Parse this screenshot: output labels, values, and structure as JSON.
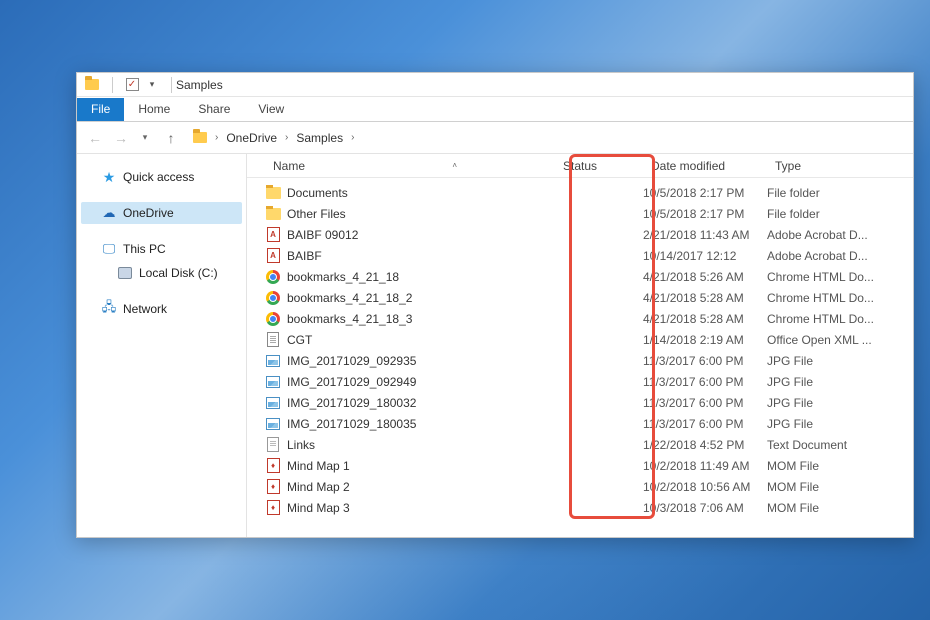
{
  "titlebar": {
    "title": "Samples"
  },
  "ribbon": {
    "file": "File",
    "home": "Home",
    "share": "Share",
    "view": "View"
  },
  "breadcrumb": {
    "parts": [
      "OneDrive",
      "Samples"
    ]
  },
  "sidebar": {
    "quick_access": "Quick access",
    "onedrive": "OneDrive",
    "this_pc": "This PC",
    "local_disk": "Local Disk (C:)",
    "network": "Network"
  },
  "columns": {
    "name": "Name",
    "status": "Status",
    "date_modified": "Date modified",
    "type": "Type"
  },
  "files": [
    {
      "icon": "folder",
      "name": "Documents",
      "date": "10/5/2018 2:17 PM",
      "type": "File folder"
    },
    {
      "icon": "folder",
      "name": "Other Files",
      "date": "10/5/2018 2:17 PM",
      "type": "File folder"
    },
    {
      "icon": "pdf",
      "name": "BAIBF 09012",
      "date": "2/21/2018 11:43 AM",
      "type": "Adobe Acrobat D..."
    },
    {
      "icon": "pdf",
      "name": "BAIBF",
      "date": "10/14/2017 12:12",
      "type": "Adobe Acrobat D..."
    },
    {
      "icon": "chrome",
      "name": "bookmarks_4_21_18",
      "date": "4/21/2018 5:26 AM",
      "type": "Chrome HTML Do..."
    },
    {
      "icon": "chrome",
      "name": "bookmarks_4_21_18_2",
      "date": "4/21/2018 5:28 AM",
      "type": "Chrome HTML Do..."
    },
    {
      "icon": "chrome",
      "name": "bookmarks_4_21_18_3",
      "date": "4/21/2018 5:28 AM",
      "type": "Chrome HTML Do..."
    },
    {
      "icon": "doc",
      "name": "CGT",
      "date": "1/14/2018 2:19 AM",
      "type": "Office Open XML ..."
    },
    {
      "icon": "img",
      "name": "IMG_20171029_092935",
      "date": "11/3/2017 6:00 PM",
      "type": "JPG File"
    },
    {
      "icon": "img",
      "name": "IMG_20171029_092949",
      "date": "11/3/2017 6:00 PM",
      "type": "JPG File"
    },
    {
      "icon": "img",
      "name": "IMG_20171029_180032",
      "date": "11/3/2017 6:00 PM",
      "type": "JPG File"
    },
    {
      "icon": "img",
      "name": "IMG_20171029_180035",
      "date": "11/3/2017 6:00 PM",
      "type": "JPG File"
    },
    {
      "icon": "txt",
      "name": "Links",
      "date": "1/22/2018 4:52 PM",
      "type": "Text Document"
    },
    {
      "icon": "mom",
      "name": "Mind Map 1",
      "date": "10/2/2018 11:49 AM",
      "type": "MOM File"
    },
    {
      "icon": "mom",
      "name": "Mind Map 2",
      "date": "10/2/2018 10:56 AM",
      "type": "MOM File"
    },
    {
      "icon": "mom",
      "name": "Mind Map 3",
      "date": "10/3/2018 7:06 AM",
      "type": "MOM File"
    }
  ]
}
